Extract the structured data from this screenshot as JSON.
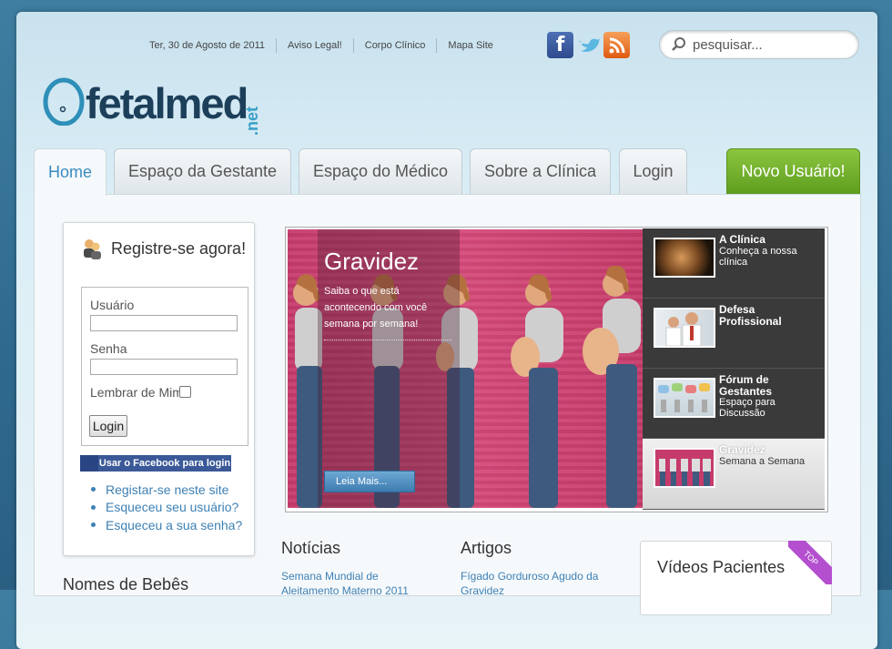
{
  "header": {
    "date": "Ter, 30 de Agosto de 2011",
    "links": [
      "Aviso Legal!",
      "Corpo Clínico",
      "Mapa Site"
    ],
    "search_placeholder": "pesquisar...",
    "logo_word": "fetalmed",
    "logo_suffix": ".net"
  },
  "nav": {
    "tabs": [
      "Home",
      "Espaço da Gestante",
      "Espaço do Médico",
      "Sobre a Clínica",
      "Login"
    ],
    "new_user": "Novo Usuário!"
  },
  "register": {
    "title": "Registre-se agora!",
    "user_label": "Usuário",
    "password_label": "Senha",
    "remember_label": "Lembrar de Mim",
    "login_button": "Login",
    "facebook_button": "Usar o Facebook para login",
    "links": [
      "Registar-se neste site",
      "Esqueceu seu usuário?",
      "Esqueceu a sua senha?"
    ]
  },
  "banner": {
    "title": "Gravidez",
    "description": "Saiba o que está acontecendo com você semana por semana!",
    "read_more": "Leia Mais...",
    "items": [
      {
        "title": "A Clínica",
        "subtitle": "Conheça a nossa clínica"
      },
      {
        "title": "Defesa Profissional",
        "subtitle": ""
      },
      {
        "title": "Fórum de Gestantes",
        "subtitle": "Espaço para Discussão"
      },
      {
        "title": "Gravidez",
        "subtitle": "Semana a Semana"
      }
    ]
  },
  "sections": {
    "noticias": "Notícias",
    "noticias_first": "Semana Mundial de Aleitamento Materno 2011",
    "artigos": "Artigos",
    "artigos_first": "Fígado Gorduroso Agudo da Gravidez",
    "videos": "Vídeos Pacientes",
    "videos_badge": "TOP",
    "nomes": "Nomes de Bebês"
  },
  "colors": {
    "accent": "#3a8cc0",
    "new_user_green": "#6fae2c",
    "hero_pink": "#c63b6c"
  }
}
